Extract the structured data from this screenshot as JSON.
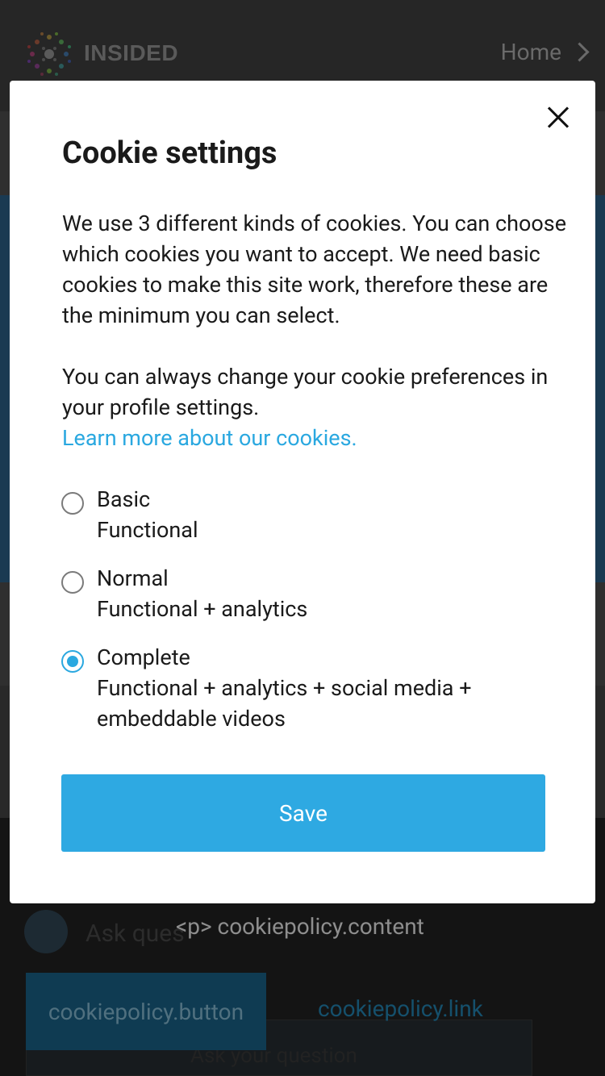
{
  "background": {
    "brand": "INSIDED",
    "nav_home": "Home",
    "ask_text": "Ask ques",
    "cookie_content": "<p> cookiepolicy.content",
    "cookie_button": "cookiepolicy.button",
    "cookie_link": "cookiepolicy.link",
    "bottom_input": "Ask your question"
  },
  "modal": {
    "title": "Cookie settings",
    "description": "We use 3 different kinds of cookies. You can choose which cookies you want to accept. We need basic cookies to make this site work, therefore these are the minimum you can select.",
    "description2": "You can always change your cookie preferences in your profile settings.",
    "learn_more": "Learn more about our cookies.",
    "options": [
      {
        "label": "Basic",
        "desc": "Functional",
        "selected": false
      },
      {
        "label": "Normal",
        "desc": "Functional + analytics",
        "selected": false
      },
      {
        "label": "Complete",
        "desc": "Functional + analytics + social media + embeddable videos",
        "selected": true
      }
    ],
    "save_label": "Save"
  },
  "colors": {
    "accent": "#2ea9e2",
    "overlay_dark": "#1b1b1b"
  }
}
